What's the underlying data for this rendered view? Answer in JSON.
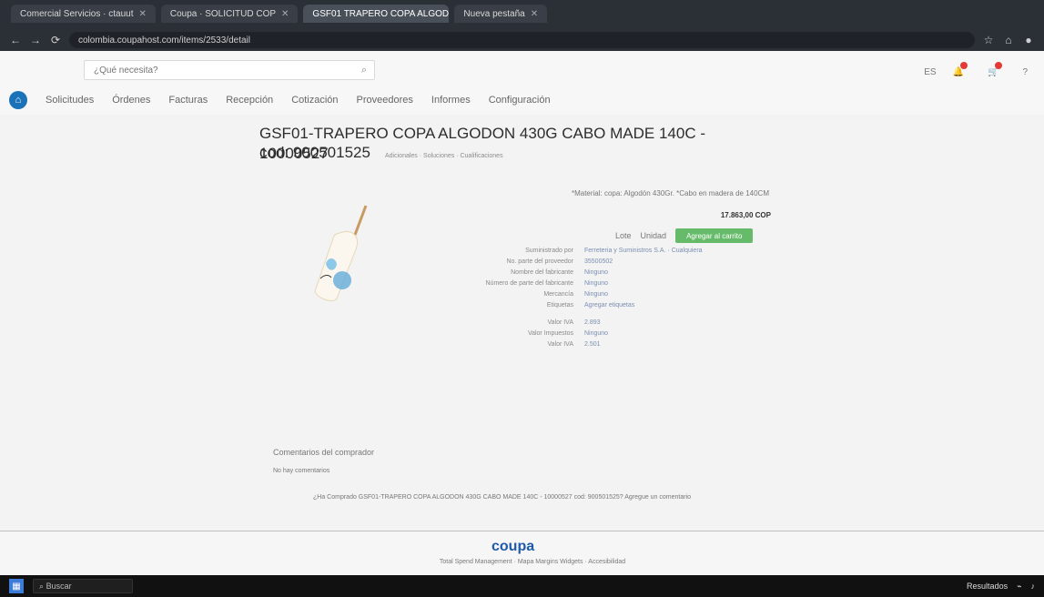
{
  "browser": {
    "tabs": [
      {
        "label": "Comercial Servicios · ctauut"
      },
      {
        "label": "Coupa · SOLICITUD COP"
      },
      {
        "label": "GSF01 TRAPERO COPA ALGOD"
      },
      {
        "label": "Nueva pestaña"
      }
    ],
    "url": "colombia.coupahost.com/items/2533/detail"
  },
  "app": {
    "logo_text": "",
    "search_placeholder": "¿Qué necesita?",
    "language": "ES",
    "menu": [
      "Solicitudes",
      "Órdenes",
      "Facturas",
      "Recepción",
      "Cotización",
      "Proveedores",
      "Informes",
      "Configuración"
    ]
  },
  "product": {
    "title": "GSF01-TRAPERO COPA ALGODON 430G CABO MADE 140C - 10000527",
    "code": "cod: 900501525",
    "code_small": "Adicionales · Soluciones · Cualificaciones",
    "description": "*Material: copa: Algodón 430Gr. *Cabo en madera de 140CM",
    "price": "17.863,00 COP",
    "qty_label": "Unidad",
    "qty_label2": "Lote",
    "add_button": "Agregar al carrito",
    "details": [
      {
        "k": "Suministrado por",
        "v": "Ferreteria y Suministros S.A. · Cualquiera"
      },
      {
        "k": "No. parte del proveedor",
        "v": "35500502"
      },
      {
        "k": "Nombre del fabricante",
        "v": "Ninguno"
      },
      {
        "k": "Número de parte del fabricante",
        "v": "Ninguno"
      },
      {
        "k": "Mercancía",
        "v": "Ninguno"
      },
      {
        "k": "Etiquetas",
        "v": "Agregar etiquetas"
      },
      {
        "k": "Valor IVA",
        "v": "2.893"
      },
      {
        "k": "Valor Impuestos",
        "v": "Ninguno"
      },
      {
        "k": "Valor IVA",
        "v": "2.501"
      }
    ]
  },
  "comments": {
    "title": "Comentarios del comprador",
    "none": "No hay comentarios",
    "prompt": "¿Ha Comprado GSF01-TRAPERO COPA ALGODON 430G CABO MADE 140C - 10000527 cod: 900501525? Agregue un comentario"
  },
  "footer": {
    "brand": "coupa",
    "line": "Total Spend Management · Mapa Margins Widgets · Accesibilidad"
  },
  "taskbar": {
    "search": "Buscar",
    "tray_text": "Resultados"
  }
}
